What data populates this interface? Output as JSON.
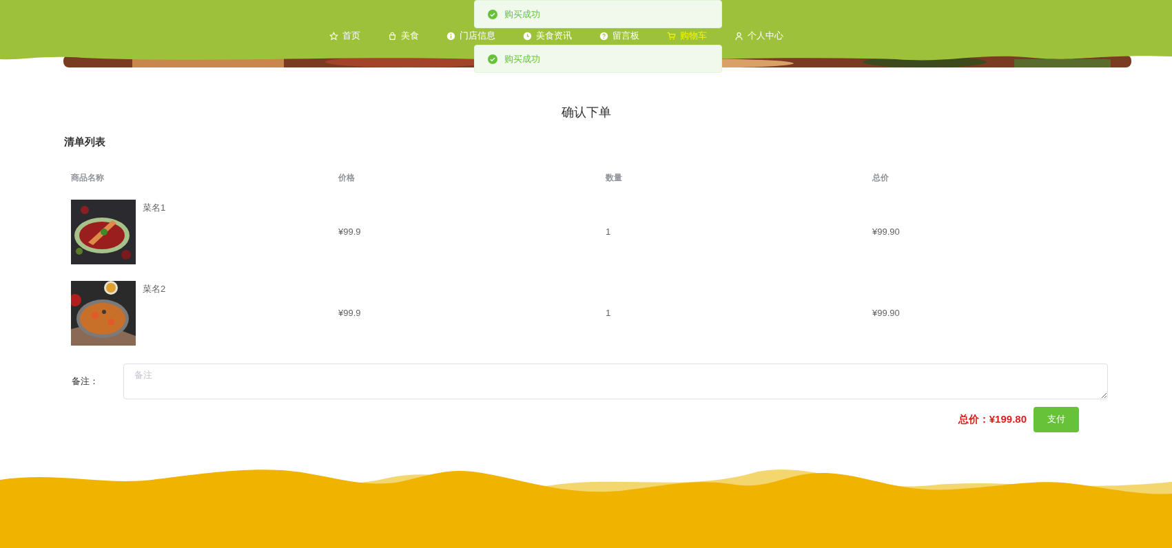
{
  "toasts": [
    {
      "message": "购买成功"
    },
    {
      "message": "购买成功"
    }
  ],
  "nav": [
    {
      "label": "首页",
      "selected": false
    },
    {
      "label": "美食",
      "selected": false
    },
    {
      "label": "门店信息",
      "selected": false
    },
    {
      "label": "美食资讯",
      "selected": false
    },
    {
      "label": "留言板",
      "selected": false
    },
    {
      "label": "购物车",
      "selected": true
    },
    {
      "label": "个人中心",
      "selected": false
    }
  ],
  "page_title": "确认下单",
  "section_title": "清单列表",
  "table": {
    "columns": [
      "商品名称",
      "价格",
      "数量",
      "总价"
    ],
    "rows": [
      {
        "name": "菜名1",
        "price": "¥99.9",
        "quantity": "1",
        "total": "¥99.90"
      },
      {
        "name": "菜名2",
        "price": "¥99.9",
        "quantity": "1",
        "total": "¥99.90"
      }
    ]
  },
  "remark": {
    "label": "备注：",
    "placeholder": "备注"
  },
  "total": "总价：¥199.80",
  "pay_button": "支付"
}
